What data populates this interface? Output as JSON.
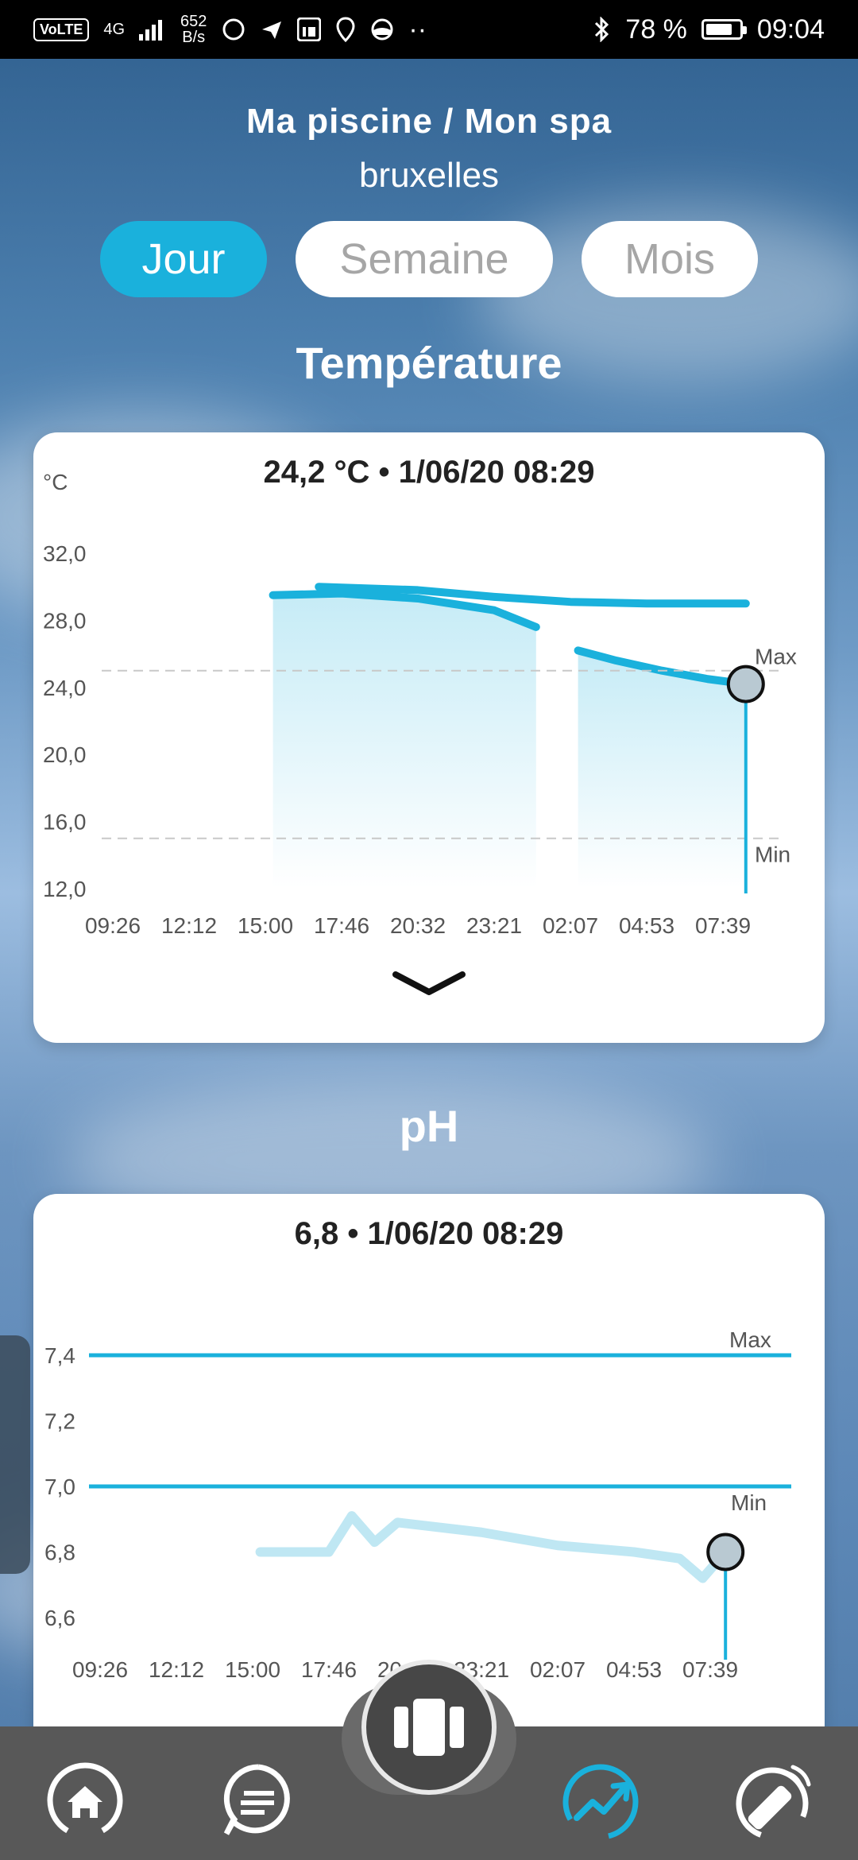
{
  "status_bar": {
    "network_badge": "VoLTE",
    "signal_label": "4G",
    "speed_value": "652",
    "speed_unit": "B/s",
    "more": "··",
    "battery": "78 %",
    "time": "09:04"
  },
  "header": {
    "title": "Ma piscine / Mon spa",
    "subtitle": "bruxelles"
  },
  "period_tabs": [
    {
      "label": "Jour",
      "active": true
    },
    {
      "label": "Semaine",
      "active": false
    },
    {
      "label": "Mois",
      "active": false
    }
  ],
  "temperature": {
    "section_title": "Température",
    "reading": "24,2 °C • 1/06/20 08:29",
    "unit_label": "°C",
    "max_label": "Max",
    "min_label": "Min"
  },
  "ph": {
    "section_title": "pH",
    "reading": "6,8 • 1/06/20 08:29",
    "max_label": "Max",
    "min_label": "Min"
  },
  "chart_data": [
    {
      "type": "area",
      "title": "24,2 °C • 1/06/20 08:29",
      "ylabel": "°C",
      "ylim": [
        12,
        32
      ],
      "y_ticks": [
        "32,0",
        "28,0",
        "24,0",
        "20,0",
        "16,0",
        "12,0"
      ],
      "x_ticks": [
        "09:26",
        "12:12",
        "15:00",
        "17:46",
        "20:32",
        "23:21",
        "02:07",
        "04:53",
        "07:39"
      ],
      "max_threshold": 25,
      "min_threshold": 15,
      "series": [
        {
          "name": "",
          "points": [
            [
              2.1,
              29.5
            ],
            [
              3.0,
              29.6
            ],
            [
              4.0,
              29.3
            ],
            [
              5.0,
              28.6
            ],
            [
              5.55,
              27.6
            ]
          ]
        },
        {
          "name": "",
          "points": [
            [
              2.7,
              30.0
            ],
            [
              4.0,
              29.8
            ],
            [
              5.0,
              29.4
            ],
            [
              6.0,
              29.1
            ],
            [
              7.0,
              29.0
            ],
            [
              8.3,
              29.0
            ]
          ]
        },
        {
          "name": "",
          "points": [
            [
              6.1,
              26.2
            ],
            [
              6.6,
              25.6
            ],
            [
              7.2,
              25.0
            ],
            [
              7.8,
              24.5
            ],
            [
              8.3,
              24.2
            ]
          ]
        }
      ],
      "current": {
        "x": 8.3,
        "y": 24.2
      }
    },
    {
      "type": "line",
      "title": "6,8 • 1/06/20 08:29",
      "ylim": [
        6.6,
        7.4
      ],
      "y_ticks": [
        "7,4",
        "7,2",
        "7,0",
        "6,8",
        "6,6"
      ],
      "x_ticks": [
        "09:26",
        "12:12",
        "15:00",
        "17:46",
        "20:32",
        "23:21",
        "02:07",
        "04:53",
        "07:39"
      ],
      "max_threshold": 7.4,
      "min_threshold": 7.0,
      "series": [
        {
          "name": "",
          "points": [
            [
              2.1,
              6.8
            ],
            [
              3.0,
              6.8
            ],
            [
              3.3,
              6.91
            ],
            [
              3.6,
              6.83
            ],
            [
              3.9,
              6.89
            ],
            [
              5.0,
              6.86
            ],
            [
              6.0,
              6.82
            ],
            [
              7.0,
              6.8
            ],
            [
              7.6,
              6.78
            ],
            [
              7.9,
              6.72
            ],
            [
              8.2,
              6.8
            ]
          ]
        }
      ],
      "current": {
        "x": 8.2,
        "y": 6.8
      }
    }
  ],
  "nav": {
    "items": [
      {
        "icon": "home-icon"
      },
      {
        "icon": "messages-icon"
      },
      {
        "icon": "center-device-icon"
      },
      {
        "icon": "stats-icon"
      },
      {
        "icon": "remote-icon"
      }
    ],
    "accent": "#1ab1dc"
  }
}
